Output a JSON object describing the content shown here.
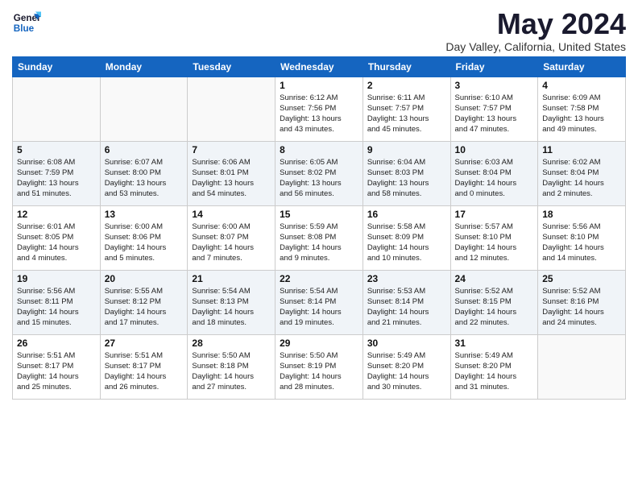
{
  "logo": {
    "line1": "General",
    "line2": "Blue"
  },
  "title": "May 2024",
  "subtitle": "Day Valley, California, United States",
  "weekdays": [
    "Sunday",
    "Monday",
    "Tuesday",
    "Wednesday",
    "Thursday",
    "Friday",
    "Saturday"
  ],
  "weeks": [
    [
      {
        "day": "",
        "info": ""
      },
      {
        "day": "",
        "info": ""
      },
      {
        "day": "",
        "info": ""
      },
      {
        "day": "1",
        "info": "Sunrise: 6:12 AM\nSunset: 7:56 PM\nDaylight: 13 hours\nand 43 minutes."
      },
      {
        "day": "2",
        "info": "Sunrise: 6:11 AM\nSunset: 7:57 PM\nDaylight: 13 hours\nand 45 minutes."
      },
      {
        "day": "3",
        "info": "Sunrise: 6:10 AM\nSunset: 7:57 PM\nDaylight: 13 hours\nand 47 minutes."
      },
      {
        "day": "4",
        "info": "Sunrise: 6:09 AM\nSunset: 7:58 PM\nDaylight: 13 hours\nand 49 minutes."
      }
    ],
    [
      {
        "day": "5",
        "info": "Sunrise: 6:08 AM\nSunset: 7:59 PM\nDaylight: 13 hours\nand 51 minutes."
      },
      {
        "day": "6",
        "info": "Sunrise: 6:07 AM\nSunset: 8:00 PM\nDaylight: 13 hours\nand 53 minutes."
      },
      {
        "day": "7",
        "info": "Sunrise: 6:06 AM\nSunset: 8:01 PM\nDaylight: 13 hours\nand 54 minutes."
      },
      {
        "day": "8",
        "info": "Sunrise: 6:05 AM\nSunset: 8:02 PM\nDaylight: 13 hours\nand 56 minutes."
      },
      {
        "day": "9",
        "info": "Sunrise: 6:04 AM\nSunset: 8:03 PM\nDaylight: 13 hours\nand 58 minutes."
      },
      {
        "day": "10",
        "info": "Sunrise: 6:03 AM\nSunset: 8:04 PM\nDaylight: 14 hours\nand 0 minutes."
      },
      {
        "day": "11",
        "info": "Sunrise: 6:02 AM\nSunset: 8:04 PM\nDaylight: 14 hours\nand 2 minutes."
      }
    ],
    [
      {
        "day": "12",
        "info": "Sunrise: 6:01 AM\nSunset: 8:05 PM\nDaylight: 14 hours\nand 4 minutes."
      },
      {
        "day": "13",
        "info": "Sunrise: 6:00 AM\nSunset: 8:06 PM\nDaylight: 14 hours\nand 5 minutes."
      },
      {
        "day": "14",
        "info": "Sunrise: 6:00 AM\nSunset: 8:07 PM\nDaylight: 14 hours\nand 7 minutes."
      },
      {
        "day": "15",
        "info": "Sunrise: 5:59 AM\nSunset: 8:08 PM\nDaylight: 14 hours\nand 9 minutes."
      },
      {
        "day": "16",
        "info": "Sunrise: 5:58 AM\nSunset: 8:09 PM\nDaylight: 14 hours\nand 10 minutes."
      },
      {
        "day": "17",
        "info": "Sunrise: 5:57 AM\nSunset: 8:10 PM\nDaylight: 14 hours\nand 12 minutes."
      },
      {
        "day": "18",
        "info": "Sunrise: 5:56 AM\nSunset: 8:10 PM\nDaylight: 14 hours\nand 14 minutes."
      }
    ],
    [
      {
        "day": "19",
        "info": "Sunrise: 5:56 AM\nSunset: 8:11 PM\nDaylight: 14 hours\nand 15 minutes."
      },
      {
        "day": "20",
        "info": "Sunrise: 5:55 AM\nSunset: 8:12 PM\nDaylight: 14 hours\nand 17 minutes."
      },
      {
        "day": "21",
        "info": "Sunrise: 5:54 AM\nSunset: 8:13 PM\nDaylight: 14 hours\nand 18 minutes."
      },
      {
        "day": "22",
        "info": "Sunrise: 5:54 AM\nSunset: 8:14 PM\nDaylight: 14 hours\nand 19 minutes."
      },
      {
        "day": "23",
        "info": "Sunrise: 5:53 AM\nSunset: 8:14 PM\nDaylight: 14 hours\nand 21 minutes."
      },
      {
        "day": "24",
        "info": "Sunrise: 5:52 AM\nSunset: 8:15 PM\nDaylight: 14 hours\nand 22 minutes."
      },
      {
        "day": "25",
        "info": "Sunrise: 5:52 AM\nSunset: 8:16 PM\nDaylight: 14 hours\nand 24 minutes."
      }
    ],
    [
      {
        "day": "26",
        "info": "Sunrise: 5:51 AM\nSunset: 8:17 PM\nDaylight: 14 hours\nand 25 minutes."
      },
      {
        "day": "27",
        "info": "Sunrise: 5:51 AM\nSunset: 8:17 PM\nDaylight: 14 hours\nand 26 minutes."
      },
      {
        "day": "28",
        "info": "Sunrise: 5:50 AM\nSunset: 8:18 PM\nDaylight: 14 hours\nand 27 minutes."
      },
      {
        "day": "29",
        "info": "Sunrise: 5:50 AM\nSunset: 8:19 PM\nDaylight: 14 hours\nand 28 minutes."
      },
      {
        "day": "30",
        "info": "Sunrise: 5:49 AM\nSunset: 8:20 PM\nDaylight: 14 hours\nand 30 minutes."
      },
      {
        "day": "31",
        "info": "Sunrise: 5:49 AM\nSunset: 8:20 PM\nDaylight: 14 hours\nand 31 minutes."
      },
      {
        "day": "",
        "info": ""
      }
    ]
  ]
}
